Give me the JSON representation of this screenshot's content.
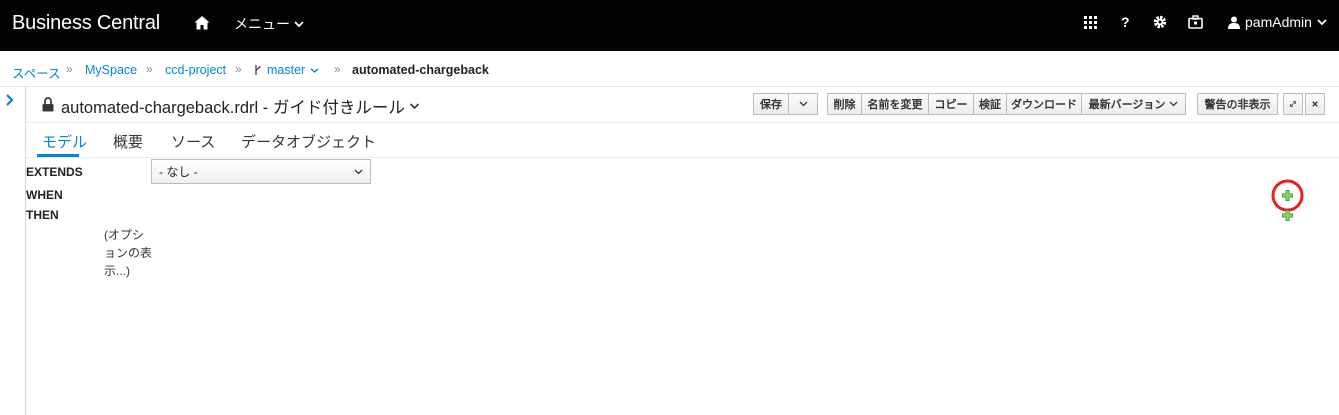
{
  "navbar": {
    "brand": "Business Central",
    "menu_label": "メニュー",
    "help_label": "?",
    "user_label": "pamAdmin"
  },
  "breadcrumb": {
    "items": [
      "スペース",
      "MySpace",
      "ccd-project",
      "master",
      "automated-chargeback"
    ],
    "separator": "»"
  },
  "editor": {
    "title": "automated-chargeback.rdrl - ガイド付きルール",
    "toolbar_save": [
      "保存"
    ],
    "toolbar_actions": [
      "削除",
      "名前を変更",
      "コピー",
      "検証",
      "ダウンロード",
      "最新バージョン"
    ],
    "toolbar_hide_warnings": "警告の非表示"
  },
  "tabs": [
    "モデル",
    "概要",
    "ソース",
    "データオブジェクト"
  ],
  "rule": {
    "extends_label": "EXTENDS",
    "extends_value": "- なし -",
    "when_label": "WHEN",
    "then_label": "THEN",
    "options_line1": "(オプシ",
    "options_line2": "ョンの表",
    "options_line3": "示...)"
  },
  "colors": {
    "navbar_bg": "#030303",
    "link_blue": "#0088ce",
    "add_green": "#3f9c35",
    "highlight_red": "#e8211f"
  },
  "icons": [
    "home-icon",
    "chevron-down-icon",
    "grid-icon",
    "gear-icon",
    "briefcase-icon",
    "user-icon",
    "branch-icon",
    "lock-icon",
    "expand-icon",
    "close-icon",
    "plus-icon",
    "angle-right-icon"
  ]
}
